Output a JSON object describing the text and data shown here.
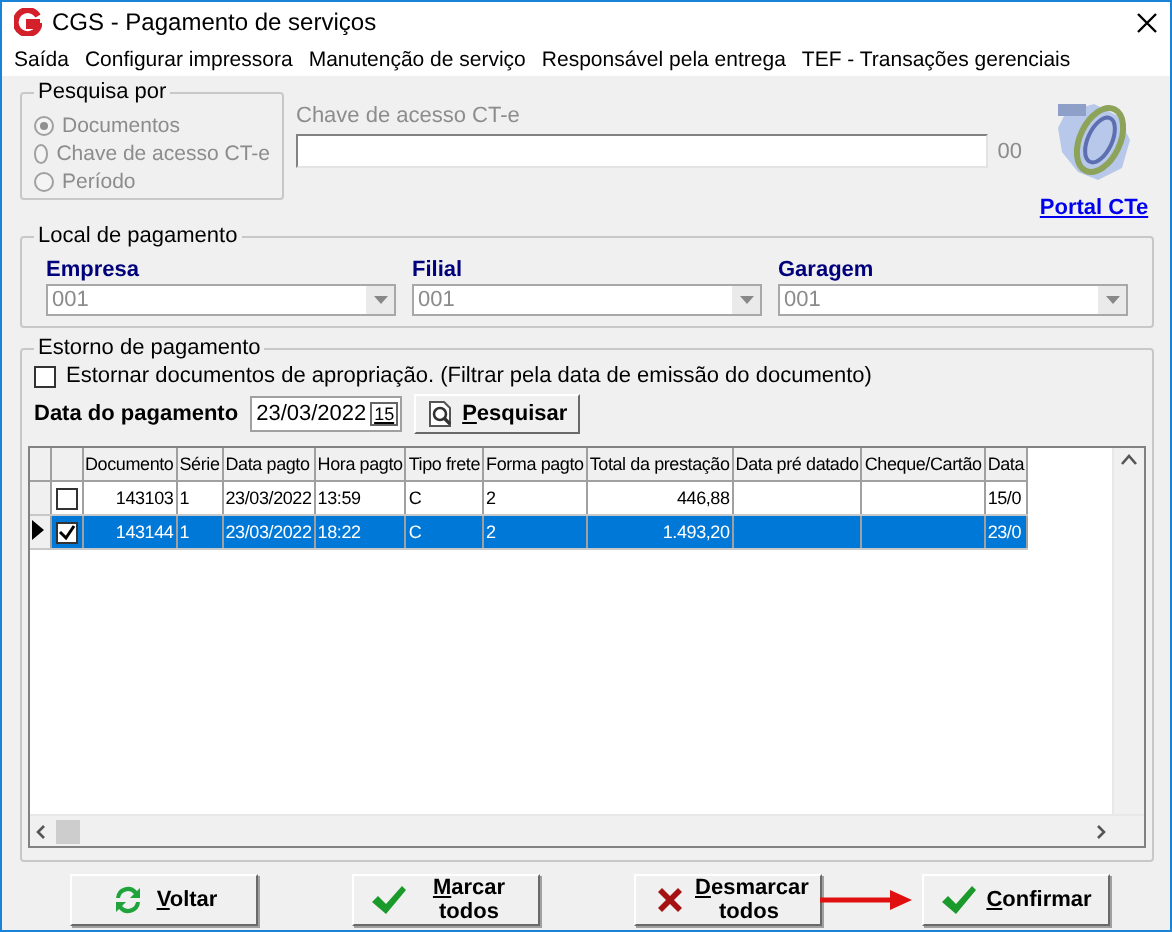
{
  "window": {
    "title": "CGS - Pagamento de serviços"
  },
  "menu": [
    "Saída",
    "Configurar impressora",
    "Manutenção de serviço",
    "Responsável pela entrega",
    "TEF - Transações gerenciais"
  ],
  "search_by": {
    "title": "Pesquisa por",
    "disabled": true,
    "options": [
      {
        "label": "Documentos",
        "selected": true
      },
      {
        "label": "Chave de acesso CT-e",
        "selected": false
      },
      {
        "label": "Período",
        "selected": false
      }
    ]
  },
  "access_key": {
    "label": "Chave de acesso CT-e",
    "disabled": true,
    "suffix": "00"
  },
  "portal_link": "Portal CTe",
  "payment_place": {
    "title": "Local de pagamento",
    "fields": [
      {
        "label": "Empresa",
        "value": "001"
      },
      {
        "label": "Filial",
        "value": "001"
      },
      {
        "label": "Garagem",
        "value": "001"
      }
    ]
  },
  "reversal": {
    "title": "Estorno de pagamento",
    "checkbox": {
      "label": "Estornar documentos de apropriação. (Filtrar pela data de emissão do documento)",
      "checked": false
    },
    "date_label": "Data do pagamento",
    "date": "23/03/2022",
    "calendar": "15",
    "search_button": "Pesquisar"
  },
  "table": {
    "columns": [
      "Documento",
      "Série",
      "Data pagto",
      "Hora pagto",
      "Tipo frete",
      "Forma pagto",
      "Total da prestação",
      "Data pré datado",
      "Cheque/Cartão",
      "Data"
    ],
    "rows": [
      {
        "selected": false,
        "checked": false,
        "cells": [
          "143103",
          "1",
          "23/03/2022",
          "13:59",
          "C",
          "2",
          "446,88",
          "",
          "",
          "15/0"
        ]
      },
      {
        "selected": true,
        "checked": true,
        "cells": [
          "143144",
          "1",
          "23/03/2022",
          "18:22",
          "C",
          "2",
          "1.493,20",
          "",
          "",
          "23/0"
        ]
      }
    ]
  },
  "buttons": [
    {
      "label": "Voltar",
      "kind": "back"
    },
    {
      "label": "Marcar todos",
      "kind": "check"
    },
    {
      "label": "Desmarcar todos",
      "kind": "uncheck"
    },
    {
      "label": "Confirmar",
      "kind": "confirm"
    }
  ]
}
